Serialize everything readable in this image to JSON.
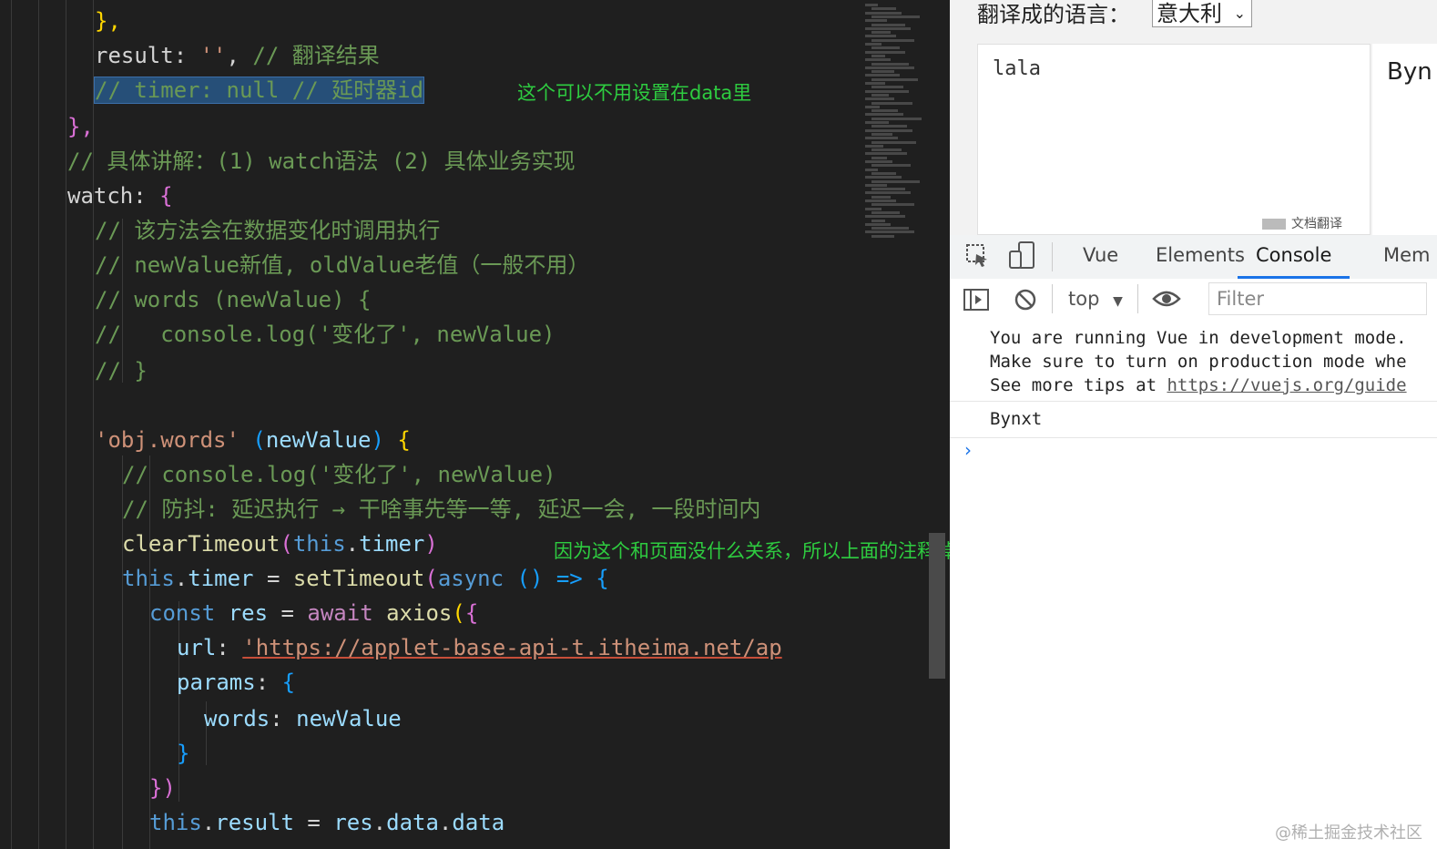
{
  "editor": {
    "lines": [
      [
        {
          "t": "},",
          "c": "b1"
        }
      ],
      [
        {
          "t": "result",
          "c": "plain"
        },
        {
          "t": ": ",
          "c": "plain"
        },
        {
          "t": "''",
          "c": "str"
        },
        {
          "t": ", ",
          "c": "plain"
        },
        {
          "t": "// 翻译结果",
          "c": "cm"
        }
      ],
      [
        {
          "t": "// timer: null // 延时器id",
          "c": "cm sel"
        }
      ],
      [
        {
          "t": "},",
          "c": "b2"
        }
      ],
      [
        {
          "t": "// 具体讲解：(1) watch语法 (2) 具体业务实现",
          "c": "cm"
        }
      ],
      [
        {
          "t": "watch",
          "c": "plain"
        },
        {
          "t": ": ",
          "c": "plain"
        },
        {
          "t": "{",
          "c": "b2"
        }
      ],
      [
        {
          "t": "// 该方法会在数据变化时调用执行",
          "c": "cm"
        }
      ],
      [
        {
          "t": "// newValue新值, oldValue老值（一般不用）",
          "c": "cm"
        }
      ],
      [
        {
          "t": "// words (newValue) {",
          "c": "cm"
        }
      ],
      [
        {
          "t": "//   console.log('变化了', newValue)",
          "c": "cm"
        }
      ],
      [
        {
          "t": "// }",
          "c": "cm"
        }
      ],
      [],
      [
        {
          "t": "'obj.words'",
          "c": "str"
        },
        {
          "t": " (",
          "c": "b3"
        },
        {
          "t": "newValue",
          "c": "prop"
        },
        {
          "t": ") ",
          "c": "b3"
        },
        {
          "t": "{",
          "c": "b1"
        }
      ],
      [
        {
          "t": "// console.log('变化了', newValue)",
          "c": "cm"
        }
      ],
      [
        {
          "t": "// 防抖: 延迟执行 → 干啥事先等一等, 延迟一会, 一段时间内",
          "c": "cm"
        }
      ],
      [
        {
          "t": "clearTimeout",
          "c": "fn"
        },
        {
          "t": "(",
          "c": "b2"
        },
        {
          "t": "this",
          "c": "kw"
        },
        {
          "t": ".",
          "c": "plain"
        },
        {
          "t": "timer",
          "c": "prop"
        },
        {
          "t": ")",
          "c": "b2"
        }
      ],
      [
        {
          "t": "this",
          "c": "kw"
        },
        {
          "t": ".",
          "c": "plain"
        },
        {
          "t": "timer",
          "c": "prop"
        },
        {
          "t": " = ",
          "c": "plain"
        },
        {
          "t": "setTimeout",
          "c": "fn"
        },
        {
          "t": "(",
          "c": "b2"
        },
        {
          "t": "async",
          "c": "kw"
        },
        {
          "t": " () => ",
          "c": "b3"
        },
        {
          "t": "{",
          "c": "b3"
        }
      ],
      [
        {
          "t": "const",
          "c": "kw"
        },
        {
          "t": " res",
          "c": "prop"
        },
        {
          "t": " = ",
          "c": "plain"
        },
        {
          "t": "await",
          "c": "ctl"
        },
        {
          "t": " axios",
          "c": "fn"
        },
        {
          "t": "(",
          "c": "b1"
        },
        {
          "t": "{",
          "c": "b2"
        }
      ],
      [
        {
          "t": "url",
          "c": "prop"
        },
        {
          "t": ": ",
          "c": "plain"
        },
        {
          "t": "'https://applet-base-api-t.itheima.net/ap",
          "c": "str under"
        }
      ],
      [
        {
          "t": "params",
          "c": "prop"
        },
        {
          "t": ": ",
          "c": "plain"
        },
        {
          "t": "{",
          "c": "b3"
        }
      ],
      [
        {
          "t": "words",
          "c": "prop"
        },
        {
          "t": ": ",
          "c": "plain"
        },
        {
          "t": "newValue",
          "c": "prop"
        }
      ],
      [
        {
          "t": "}",
          "c": "b3"
        }
      ],
      [
        {
          "t": "})",
          "c": "b2"
        }
      ],
      [
        {
          "t": "this",
          "c": "kw"
        },
        {
          "t": ".",
          "c": "plain"
        },
        {
          "t": "result",
          "c": "prop"
        },
        {
          "t": " = ",
          "c": "plain"
        },
        {
          "t": "res",
          "c": "prop"
        },
        {
          "t": ".",
          "c": "plain"
        },
        {
          "t": "data",
          "c": "prop"
        },
        {
          "t": ".",
          "c": "plain"
        },
        {
          "t": "data",
          "c": "prop"
        }
      ]
    ],
    "annotations": {
      "note1": "这个可以不用设置在data里",
      "note2": "因为这个和页面没什么关系，所以上面的注释掉了，也不影响效果"
    }
  },
  "browser": {
    "lang_label": "翻译成的语言：",
    "lang_selected": "意大利",
    "input_text": "lala",
    "output_text": "Byn",
    "doc_translate": "文档翻译",
    "devtools": {
      "tabs": [
        "Vue",
        "Elements",
        "Console",
        "Mem"
      ],
      "active_tab": "Console",
      "context": "top",
      "filter_placeholder": "Filter",
      "messages": {
        "line1": "You are running Vue in development mode.",
        "line2": "Make sure to turn on production mode whe",
        "line3_prefix": "See more tips at ",
        "line3_link": "https://vuejs.org/guide",
        "log": "Bynxt"
      }
    }
  },
  "watermark": "@稀土掘金技术社区"
}
